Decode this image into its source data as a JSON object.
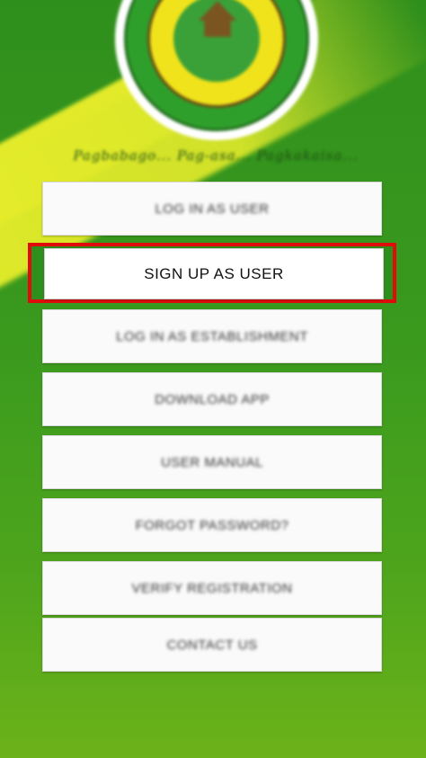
{
  "header": {
    "logo_name": "seal-logo",
    "motto": "Pagbabago... Pag-asa... Pagkakaisa..."
  },
  "menu": {
    "items": [
      {
        "label": "LOG IN AS USER"
      },
      {
        "label": "SIGN UP AS USER",
        "highlighted": true
      },
      {
        "label": "LOG IN AS ESTABLISHMENT"
      },
      {
        "label": "DOWNLOAD APP"
      },
      {
        "label": "USER MANUAL"
      },
      {
        "label": "FORGOT PASSWORD?"
      },
      {
        "label": "VERIFY REGISTRATION"
      },
      {
        "label": "CONTACT US"
      }
    ]
  },
  "colors": {
    "background_green": "#2f8f1c",
    "accent_yellow": "#e2ea2a",
    "highlight_red": "#e00c0c"
  }
}
